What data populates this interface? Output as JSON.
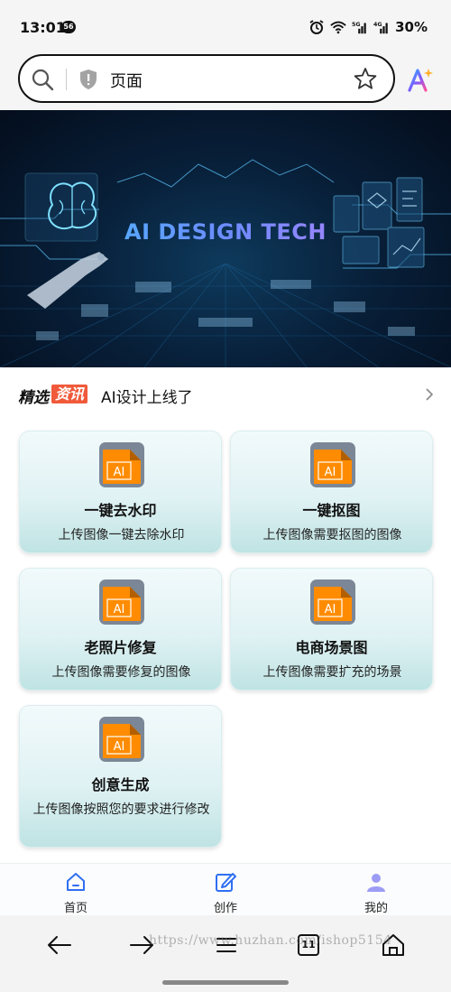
{
  "status_bar": {
    "time": "13:01",
    "notif_badge": "56",
    "network_5g": "5G",
    "network_4g": "4G",
    "battery": "30%"
  },
  "browser": {
    "url_text": "页面"
  },
  "banner": {
    "title": "AI DESIGN TECH"
  },
  "news": {
    "tag_a": "精选",
    "tag_b": "资讯",
    "text": "AI设计上线了"
  },
  "cards": [
    {
      "title": "一键去水印",
      "desc": "上传图像一键去除水印",
      "icon_label": "AI"
    },
    {
      "title": "一键抠图",
      "desc": "上传图像需要抠图的图像",
      "icon_label": "AI"
    },
    {
      "title": "老照片修复",
      "desc": "上传图像需要修复的图像",
      "icon_label": "AI"
    },
    {
      "title": "电商场景图",
      "desc": "上传图像需要扩充的场景",
      "icon_label": "AI"
    },
    {
      "title": "创意生成",
      "desc": "上传图像按照您的要求进行修改",
      "icon_label": "AI"
    }
  ],
  "tabs": [
    {
      "label": "首页",
      "icon": "home-icon"
    },
    {
      "label": "创作",
      "icon": "edit-icon"
    },
    {
      "label": "我的",
      "icon": "user-icon"
    }
  ],
  "nav": {
    "tab_count": "11",
    "watermark": "https://www.huzhan.com/ishop5154"
  },
  "colors": {
    "accent_blue": "#2f6ff2",
    "icon_orange": "#ff8c00",
    "icon_gray": "#7b8796",
    "news_tag": "#f05a3a"
  }
}
